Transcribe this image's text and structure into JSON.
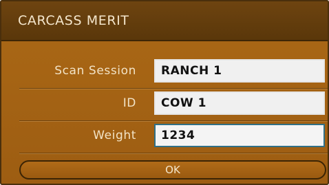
{
  "dialog": {
    "title": "CARCASS MERIT",
    "fields": [
      {
        "label": "Scan Session",
        "value": "RANCH 1"
      },
      {
        "label": "ID",
        "value": "COW 1"
      },
      {
        "label": "Weight",
        "value": "1234"
      }
    ],
    "ok_label": "OK"
  },
  "colors": {
    "panel": "#a36214",
    "title_bar": "#5a370a",
    "focus_border": "#2f6f86",
    "text_light": "#f2e3c6"
  }
}
